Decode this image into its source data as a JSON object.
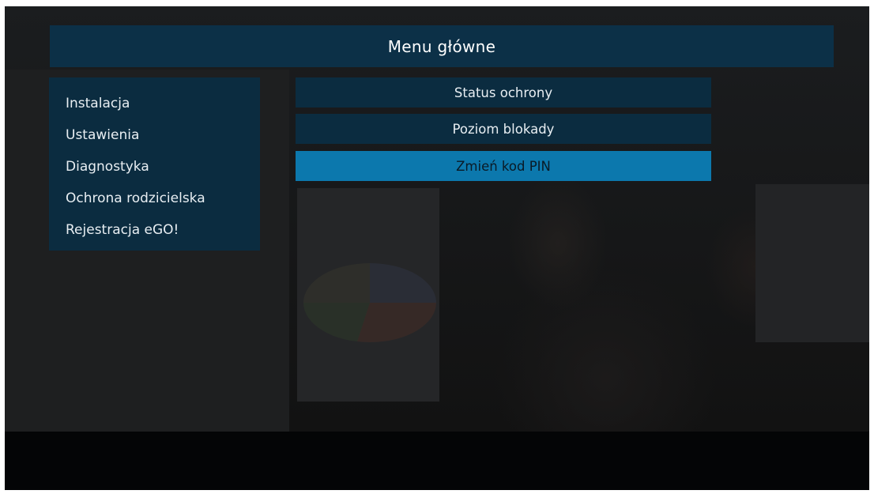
{
  "header": {
    "title": "Menu główne"
  },
  "left_menu": {
    "items": [
      {
        "label": "Instalacja"
      },
      {
        "label": "Ustawienia"
      },
      {
        "label": "Diagnostyka"
      },
      {
        "label": "Ochrona rodzicielska"
      },
      {
        "label": "Rejestracja eGO!"
      }
    ]
  },
  "submenu": {
    "items": [
      {
        "label": "Status ochrony",
        "selected": false
      },
      {
        "label": "Poziom blokady",
        "selected": false
      },
      {
        "label": "Zmień kod PIN",
        "selected": true
      }
    ]
  },
  "colors": {
    "panel": "#0b2c40",
    "header": "#0c3047",
    "highlight": "#0c78ad"
  }
}
